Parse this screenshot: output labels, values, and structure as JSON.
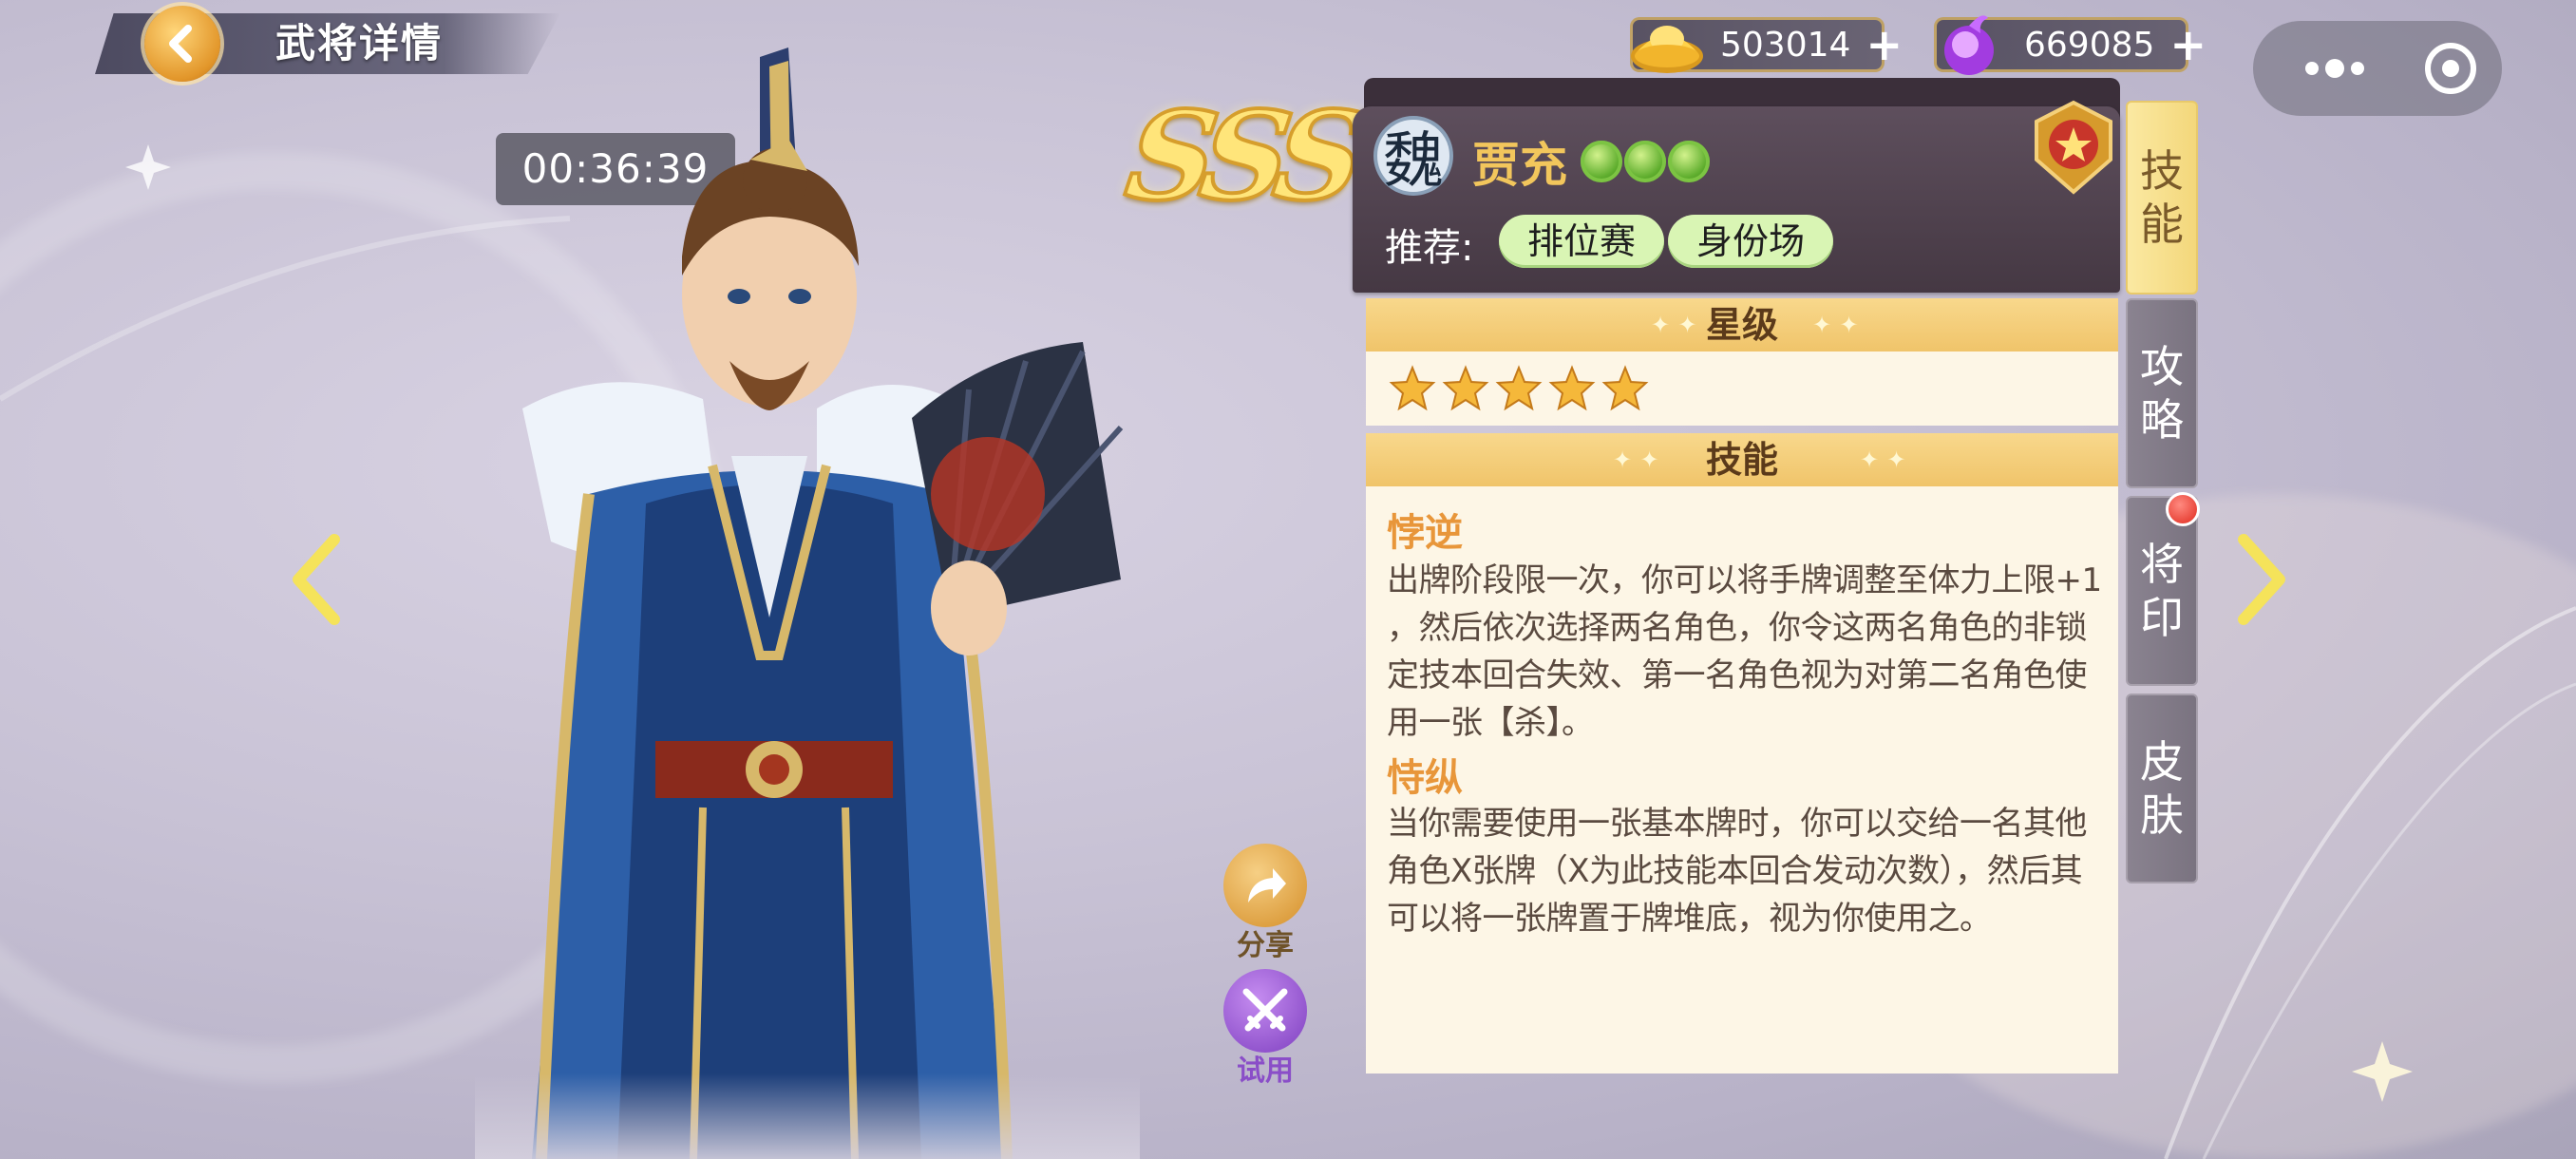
{
  "header": {
    "title": "武将详情",
    "timer": "00:36:39"
  },
  "currency": {
    "gold": "503014",
    "gems": "669085"
  },
  "general": {
    "rank": "SSS",
    "kingdom": "魏",
    "name": "贾充",
    "gem_count": 3,
    "recommend_label": "推荐:",
    "recommend_tags": [
      "排位赛",
      "身份场"
    ]
  },
  "sections": {
    "star_title": "星级",
    "star_count": 5,
    "skills_title": "技能"
  },
  "skills": [
    {
      "name": "悖逆",
      "lines": [
        "出牌阶段限一次，你可以将手牌调整至体力上限+1",
        "，然后依次选择两名角色，你令这两名角色的非锁",
        "定技本回合失效、第一名角色视为对第二名角色使",
        "用一张【杀】。"
      ]
    },
    {
      "name": "恃纵",
      "lines": [
        "当你需要使用一张基本牌时，你可以交给一名其他",
        "角色X张牌（X为此技能本回合发动次数），然后其",
        "可以将一张牌置于牌堆底，视为你使用之。"
      ]
    }
  ],
  "actions": {
    "share": "分享",
    "trial": "试用"
  },
  "tabs": [
    {
      "top": "技",
      "bottom": "能"
    },
    {
      "top": "攻",
      "bottom": "略"
    },
    {
      "top": "将",
      "bottom": "印"
    },
    {
      "top": "皮",
      "bottom": "肤"
    }
  ],
  "active_tab_index": 0,
  "colors": {
    "accent_gold": "#f0c46a",
    "panel_bg": "#fdf6e6",
    "skill_name": "#e8963a",
    "tag_green": "#d9f5b4"
  }
}
